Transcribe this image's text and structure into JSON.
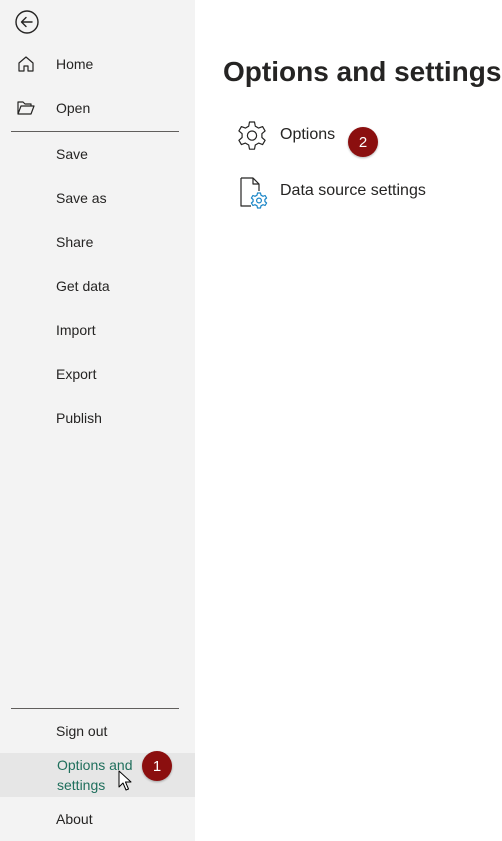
{
  "sidebar": {
    "back_icon": "arrow-left-circle-icon",
    "items": [
      {
        "label": "Home",
        "icon": "home-icon"
      },
      {
        "label": "Open",
        "icon": "folder-open-icon"
      },
      {
        "label": "Save"
      },
      {
        "label": "Save as"
      },
      {
        "label": "Share"
      },
      {
        "label": "Get data"
      },
      {
        "label": "Import"
      },
      {
        "label": "Export"
      },
      {
        "label": "Publish"
      }
    ],
    "bottom_items": [
      {
        "label": "Sign out"
      },
      {
        "label": "Options and settings",
        "selected": true
      },
      {
        "label": "About"
      }
    ]
  },
  "main": {
    "title": "Options and settings",
    "options": [
      {
        "label": "Options",
        "icon": "gear-icon"
      },
      {
        "label": "Data source settings",
        "icon": "document-gear-icon"
      }
    ]
  },
  "annotations": {
    "badge_1": "1",
    "badge_2": "2",
    "badge_color": "#8b0f0f"
  },
  "colors": {
    "sidebar_bg": "#f3f3f3",
    "selected_bg": "#e6e6e6",
    "selected_text": "#1f6f5c",
    "accent_icon": "#1a86c7"
  }
}
